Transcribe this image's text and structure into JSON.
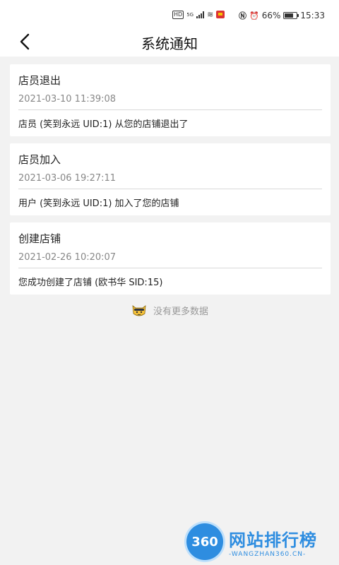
{
  "status_bar": {
    "hd_label": "HD",
    "net_label": "5G",
    "battery_percent": "66%",
    "time": "15:33"
  },
  "header": {
    "title": "系统通知"
  },
  "notifications": [
    {
      "title": "店员退出",
      "time": "2021-03-10 11:39:08",
      "message": "店员 (笑到永远 UID:1) 从您的店铺退出了"
    },
    {
      "title": "店员加入",
      "time": "2021-03-06 19:27:11",
      "message": "用户 (笑到永远 UID:1) 加入了您的店铺"
    },
    {
      "title": "创建店铺",
      "time": "2021-02-26 10:20:07",
      "message": "您成功创建了店铺 (欧书华 SID:15)"
    }
  ],
  "empty_hint": {
    "text": "没有更多数据"
  },
  "watermark": {
    "logo_text": "360",
    "title": "网站排行榜",
    "subtitle": "-WANGZHAN360.CN-"
  }
}
